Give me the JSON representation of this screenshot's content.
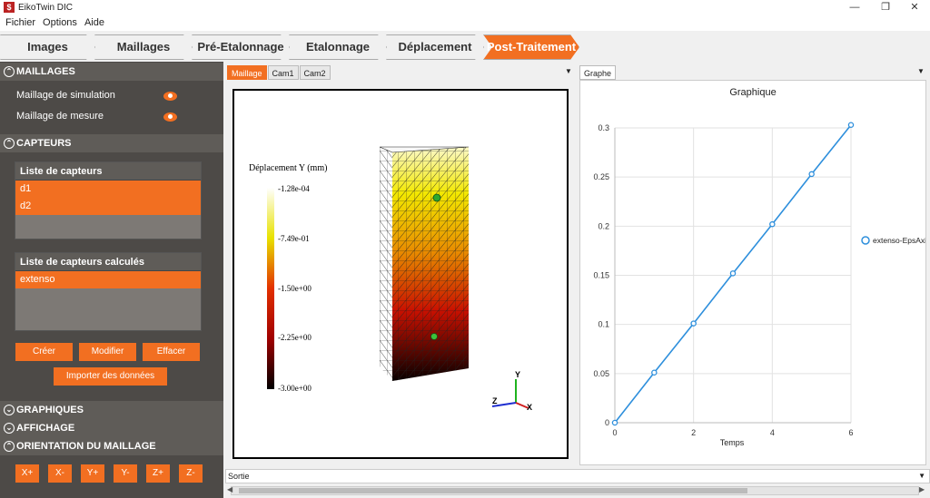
{
  "app": {
    "title": "EikoTwin DIC"
  },
  "menu": [
    "Fichier",
    "Options",
    "Aide"
  ],
  "steps": [
    "Images",
    "Maillages",
    "Pré-Etalonnage",
    "Etalonnage",
    "Déplacement",
    "Post-Traitement"
  ],
  "active_step": "Post-Traitement",
  "sidebar": {
    "maillages": {
      "title": "MAILLAGES",
      "items": [
        "Maillage de simulation",
        "Maillage de mesure"
      ]
    },
    "capteurs": {
      "title": "CAPTEURS",
      "list_title": "Liste de capteurs",
      "items": [
        "d1",
        "d2"
      ],
      "calc_title": "Liste de capteurs calculés",
      "calc_items": [
        "extenso"
      ],
      "btn_create": "Créer",
      "btn_modify": "Modifier",
      "btn_delete": "Effacer",
      "btn_import": "Importer des données"
    },
    "graphiques": "GRAPHIQUES",
    "affichage": "AFFICHAGE",
    "orientation": {
      "title": "ORIENTATION DU MAILLAGE",
      "buttons": [
        "X+",
        "X-",
        "Y+",
        "Y-",
        "Z+",
        "Z-"
      ]
    }
  },
  "viewer": {
    "tabs": [
      "Maillage",
      "Cam1",
      "Cam2"
    ],
    "colorbar": {
      "title": "Déplacement Y (mm)",
      "ticks": [
        "-1.28e-04",
        "-7.49e-01",
        "-1.50e+00",
        "-2.25e+00",
        "-3.00e+00"
      ]
    },
    "axes": {
      "y": "Y",
      "z": "Z",
      "x": "X"
    }
  },
  "graph": {
    "tab": "Graphe",
    "accent": "#2e8fdc"
  },
  "chart_data": {
    "type": "line",
    "title": "Graphique",
    "xlabel": "Temps",
    "ylabel": "",
    "x": [
      0,
      1,
      2,
      3,
      4,
      5,
      6
    ],
    "series": [
      {
        "name": "extenso-EpsAxial",
        "values": [
          0,
          0.051,
          0.101,
          0.152,
          0.202,
          0.253,
          0.303
        ]
      }
    ],
    "xlim": [
      0,
      6
    ],
    "ylim": [
      0,
      0.3
    ],
    "xticks": [
      "0",
      "2",
      "4",
      "6"
    ],
    "yticks": [
      "0",
      "0.05",
      "0.1",
      "0.15",
      "0.2",
      "0.25",
      "0.3"
    ],
    "grid": true,
    "legend": "right"
  },
  "output": {
    "title": "Sortie"
  }
}
